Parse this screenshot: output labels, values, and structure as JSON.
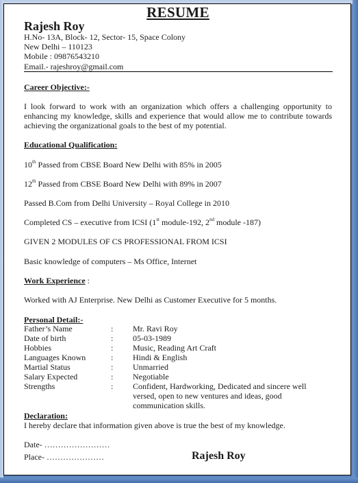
{
  "document": {
    "title": "RESUME",
    "name": "Rajesh Roy",
    "address_line1": "H.No- 13A, Block-  12, Sector- 15, Space Colony",
    "address_line2": "New Delhi – 110123",
    "mobile": "Mobile  : 09876543210",
    "email": "Email.- rajeshroy@gmail.com"
  },
  "career_objective": {
    "heading": "Career Objective:-",
    "text": "I look forward to work with an organization  which offers a challenging  opportunity to enhancing my knowledge, skills and experience  that would allow me to contribute  towards achieving  the organizational  goals to the best of my potential."
  },
  "education": {
    "heading": "Educational Qualification:",
    "items": [
      {
        "pre": "10",
        "sup": "th",
        "text": " Passed from CBSE Board  New Delhi with 85% in 2005"
      },
      {
        "pre": "12",
        "sup": "th",
        "text": " Passed from CBSE Board New Delhi with 89% in 2007"
      },
      {
        "text": "Passed B.Com  from Delhi University – Royal College in 2010"
      },
      {
        "pre": "Completed  CS – executive  from ICSI (1",
        "sup": "st",
        "mid": " module-192,  2",
        "sup2": "nd",
        "post": " module  -187)"
      },
      {
        "text": "GIVEN 2 MODULES OF CS PROFESSIONAL FROM ICSI"
      },
      {
        "text": "Basic knowledge  of computers  – Ms Office,  Internet"
      }
    ]
  },
  "work_experience": {
    "heading": "Work Experience",
    "suffix": " :",
    "text": "Worked with AJ Enterprise. New Delhi as Customer Executive  for 5 months."
  },
  "personal_detail": {
    "heading": "Personal Detail:-",
    "rows": [
      {
        "label": "Father’s Name",
        "colon": ":",
        "value": "Mr. Ravi Roy"
      },
      {
        "label": "Date of birth",
        "colon": ":",
        "value": "05-03-1989"
      },
      {
        "label": "Hobbies",
        "colon": ":",
        "value": "Music, Reading  Art Craft"
      },
      {
        "label": "Languages  Known",
        "colon": ":",
        "value": "Hindi & English"
      },
      {
        "label": "Martial Status",
        "colon": ":",
        "value": "Unmarried"
      },
      {
        "label": "Salary Expected",
        "colon": ":",
        "value": "Negotiable"
      },
      {
        "label": "Strengths",
        "colon": ":",
        "value": "Confident, Hardworking, Dedicated  and sincere well versed, open to new ventures  and ideas, good communication  skills."
      }
    ]
  },
  "declaration": {
    "heading": "Declaration:",
    "text": "I hereby  declare  that information  given  above is true the best of my knowledge.",
    "date_label": "Date- ……………………",
    "place_label": "Place- …………………",
    "signature": "Rajesh Roy"
  },
  "colors": {
    "backdrop": "#5a84bf",
    "page": "#ffffff",
    "text": "#1a1a1a"
  }
}
